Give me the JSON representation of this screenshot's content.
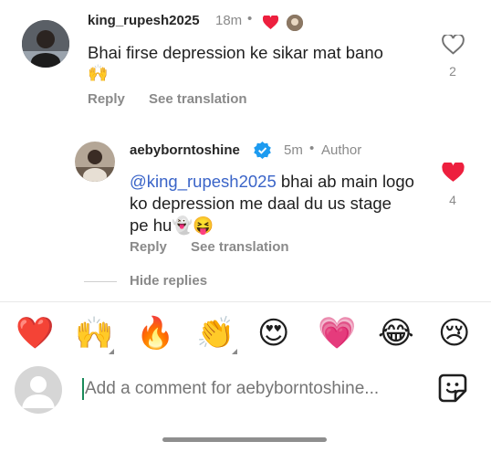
{
  "comment": {
    "username": "king_rupesh2025",
    "time": "18m",
    "text": "Bhai firse depression ke sikar mat bano",
    "emoji_line": "🙌",
    "reply_label": "Reply",
    "translate_label": "See translation",
    "like_count": "2"
  },
  "reply": {
    "username": "aebyborntoshine",
    "time": "5m",
    "author_label": "Author",
    "mention": "@king_rupesh2025",
    "text_after_mention": " bhai ab main logo ko depression me daal du us stage pe hu👻😝",
    "reply_label": "Reply",
    "translate_label": "See translation",
    "like_count": "4"
  },
  "hide_replies_label": "Hide replies",
  "emoji_bar": [
    "❤️",
    "🙌",
    "🔥",
    "👏",
    "😍",
    "💗",
    "😂",
    "😢"
  ],
  "composer": {
    "placeholder": "Add a comment for aebyborntoshine..."
  },
  "colors": {
    "like_red": "#ed1f3e",
    "mention_blue": "#3a64c8",
    "verified_blue": "#1d9bf0"
  }
}
